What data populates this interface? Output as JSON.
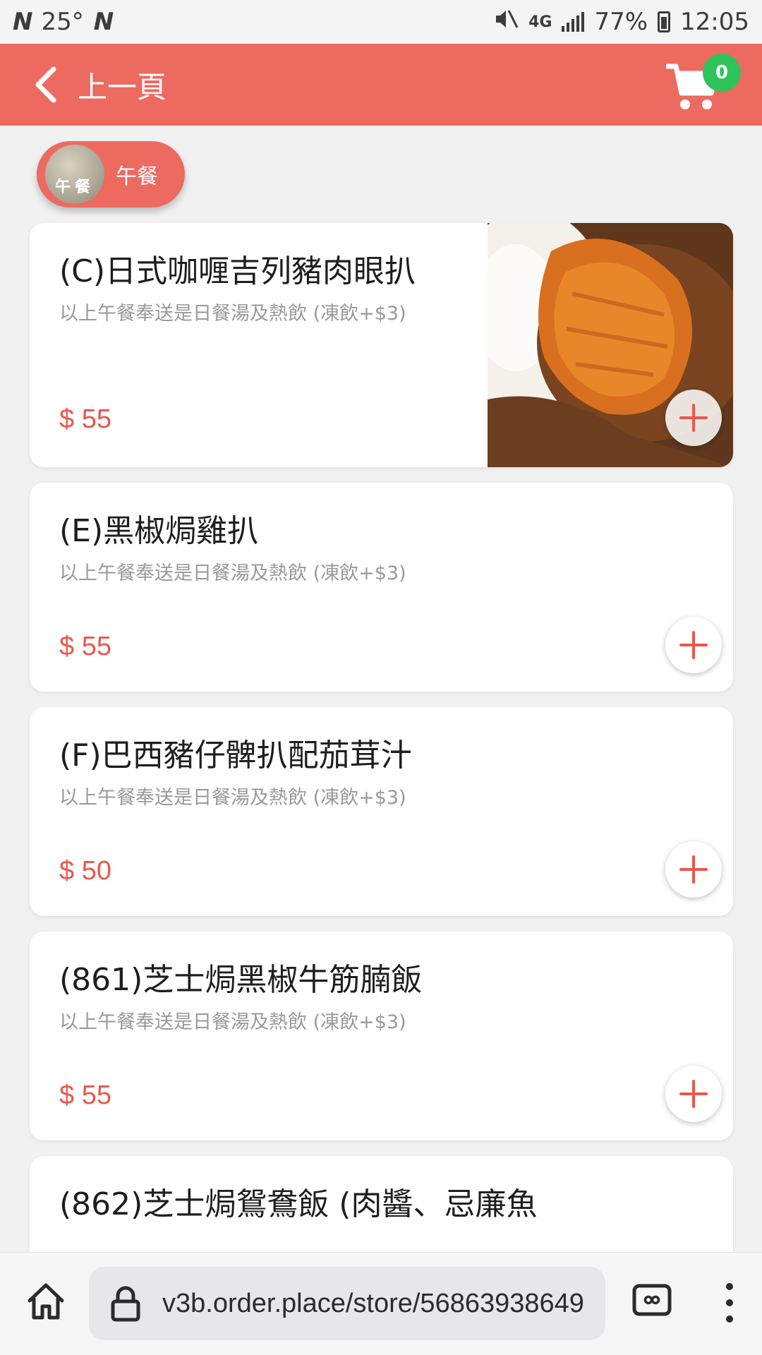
{
  "status_bar": {
    "temperature": "25°",
    "network": "4G",
    "battery": "77%",
    "time": "12:05"
  },
  "header": {
    "back_label": "上一頁",
    "cart_count": "0",
    "accent_color": "#ec6a60"
  },
  "category": {
    "thumb_text": "午餐",
    "label": "午餐"
  },
  "menu_items": [
    {
      "name": "(C)日式咖喱吉列豬肉眼扒",
      "desc": "以上午餐奉送是日餐湯及熱飲 (凍飲+$3)",
      "price": "$ 55",
      "has_image": true
    },
    {
      "name": "(E)黑椒焗雞扒",
      "desc": "以上午餐奉送是日餐湯及熱飲 (凍飲+$3)",
      "price": "$ 55",
      "has_image": false
    },
    {
      "name": "(F)巴西豬仔髀扒配茄茸汁",
      "desc": "以上午餐奉送是日餐湯及熱飲 (凍飲+$3)",
      "price": "$ 50",
      "has_image": false
    },
    {
      "name": "(861)芝士焗黑椒牛筋腩飯",
      "desc": "以上午餐奉送是日餐湯及熱飲 (凍飲+$3)",
      "price": "$ 55",
      "has_image": false
    },
    {
      "name": "(862)芝士焗鴛鴦飯 (肉醬、忌廉魚",
      "desc": "",
      "price": "",
      "has_image": false
    }
  ],
  "browser": {
    "url": "v3b.order.place/store/56863938649"
  }
}
